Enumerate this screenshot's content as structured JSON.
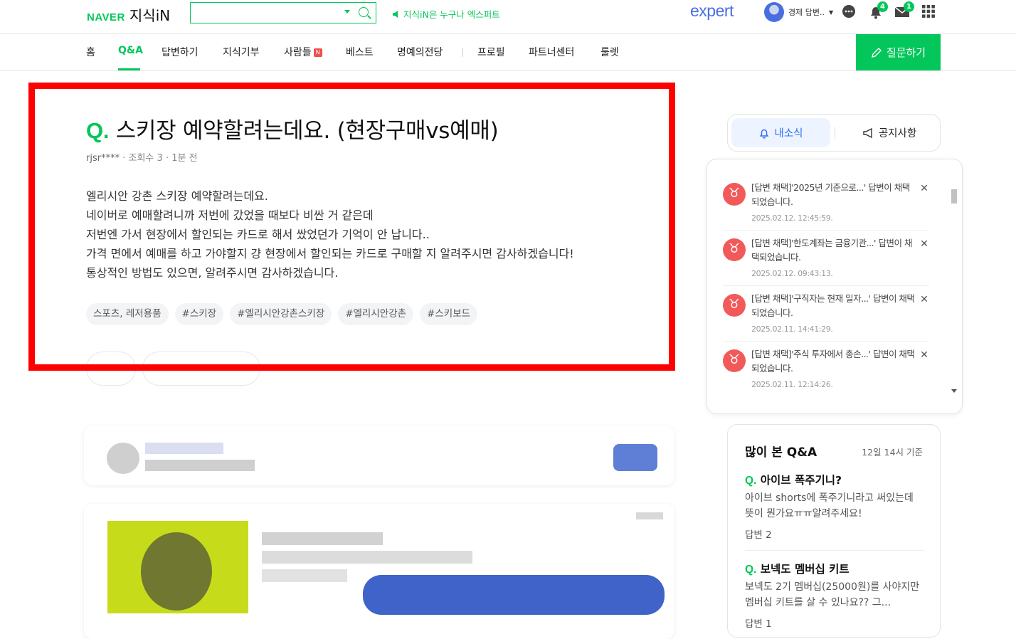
{
  "header": {
    "logo_brand": "NAVER",
    "logo_service": "지식iN",
    "search": {
      "value": "",
      "placeholder": ""
    },
    "promo_text": "지식iN은 누구나 엑스퍼트",
    "expert_label": "expert",
    "profile_name": "경제 답변..",
    "notification_count": "4",
    "mail_count": "1"
  },
  "nav": {
    "items": [
      "홈",
      "Q&A",
      "답변하기",
      "지식기부",
      "사람들",
      "베스트",
      "명예의전당",
      "프로필",
      "파트너센터",
      "룰렛"
    ],
    "active": "Q&A",
    "new_badge": "N",
    "ask_button": "질문하기"
  },
  "question": {
    "q_mark": "Q.",
    "title": "스키장 예약할려는데요. (현장구매vs예매)",
    "author": "rjsr****",
    "views_label": "조회수 3",
    "time": "1분 전",
    "separator": "·",
    "body": [
      "엘리시안 강촌 스키장 예약할려는데요.",
      "네이버로 예매할려니까 저번에 갔었을 때보다 비싼 거 같은데",
      "저번엔 가서 현장에서 할인되는 카드로 해서 쌌었던가 기억이 안 납니다..",
      "가격 면에서 예매를 하고 가야할지 걍 현장에서 할인되는 카드로 구매할 지 알려주시면 감사하겠습니다!",
      "통상적인 방법도 있으면, 알려주시면 감사하겠습니다."
    ],
    "tags": [
      "스포츠, 레저용품",
      "#스키장",
      "#엘리시안강촌스키장",
      "#엘리시안강촌",
      "#스키보드"
    ]
  },
  "sidebar": {
    "tab_news": "내소식",
    "tab_notice": "공지사항",
    "notifications": [
      {
        "text": "[답변 채택]'2025년 기준으로...' 답변이 채택되었습니다.",
        "date": "2025.02.12. 12:45:59."
      },
      {
        "text": "[답변 채택]'한도계좌는 금융기관...' 답변이 채택되었습니다.",
        "date": "2025.02.12. 09:43:13."
      },
      {
        "text": "[답변 채택]'구직자는 현재 일자...' 답변이 채택되었습니다.",
        "date": "2025.02.11. 14:41:29."
      },
      {
        "text": "[답변 채택]'주식 투자에서 총손...' 답변이 채택되었습니다.",
        "date": "2025.02.11. 12:14:26."
      }
    ],
    "popular": {
      "title": "많이 본 Q&A",
      "time": "12일 14시 기준",
      "items": [
        {
          "q": "Q.",
          "title": "아이브 폭주기니?",
          "body": "아이브 shorts에 폭주기니라고 써있는데 뜻이 뭔가요ㅠㅠ알려주세요!",
          "answers": "답변 2"
        },
        {
          "q": "Q.",
          "title": "보넥도 멤버십 키트",
          "body": "보넥도 2기 멤버십(25000원)를 사야지만 멤버십 키트를 살 수 있나요?? 그...",
          "answers": "답변 1"
        }
      ]
    }
  },
  "colors": {
    "brand_green": "#03c75a",
    "highlight_red": "#ff0000",
    "notif_red": "#f25a5a",
    "tab_blue": "#2e6ef4",
    "expert_blue": "#4a6ee0"
  }
}
